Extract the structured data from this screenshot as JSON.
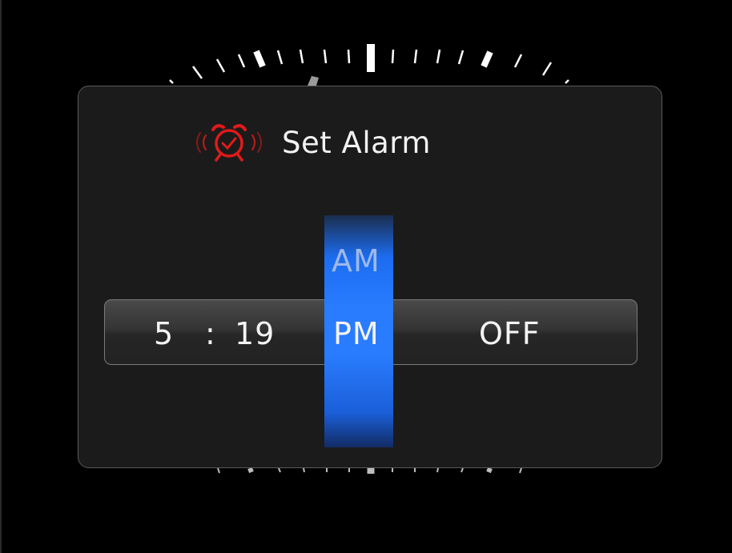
{
  "dialog": {
    "title": "Set Alarm",
    "icon": "alarm-clock-icon"
  },
  "picker": {
    "hour": "5",
    "separator": ":",
    "minute": "19",
    "meridiem_selected": "PM",
    "meridiem_other": "AM",
    "alarm_state": "OFF"
  },
  "colors": {
    "accent_blue": "#2a7cff",
    "alarm_red": "#e01a1a"
  }
}
